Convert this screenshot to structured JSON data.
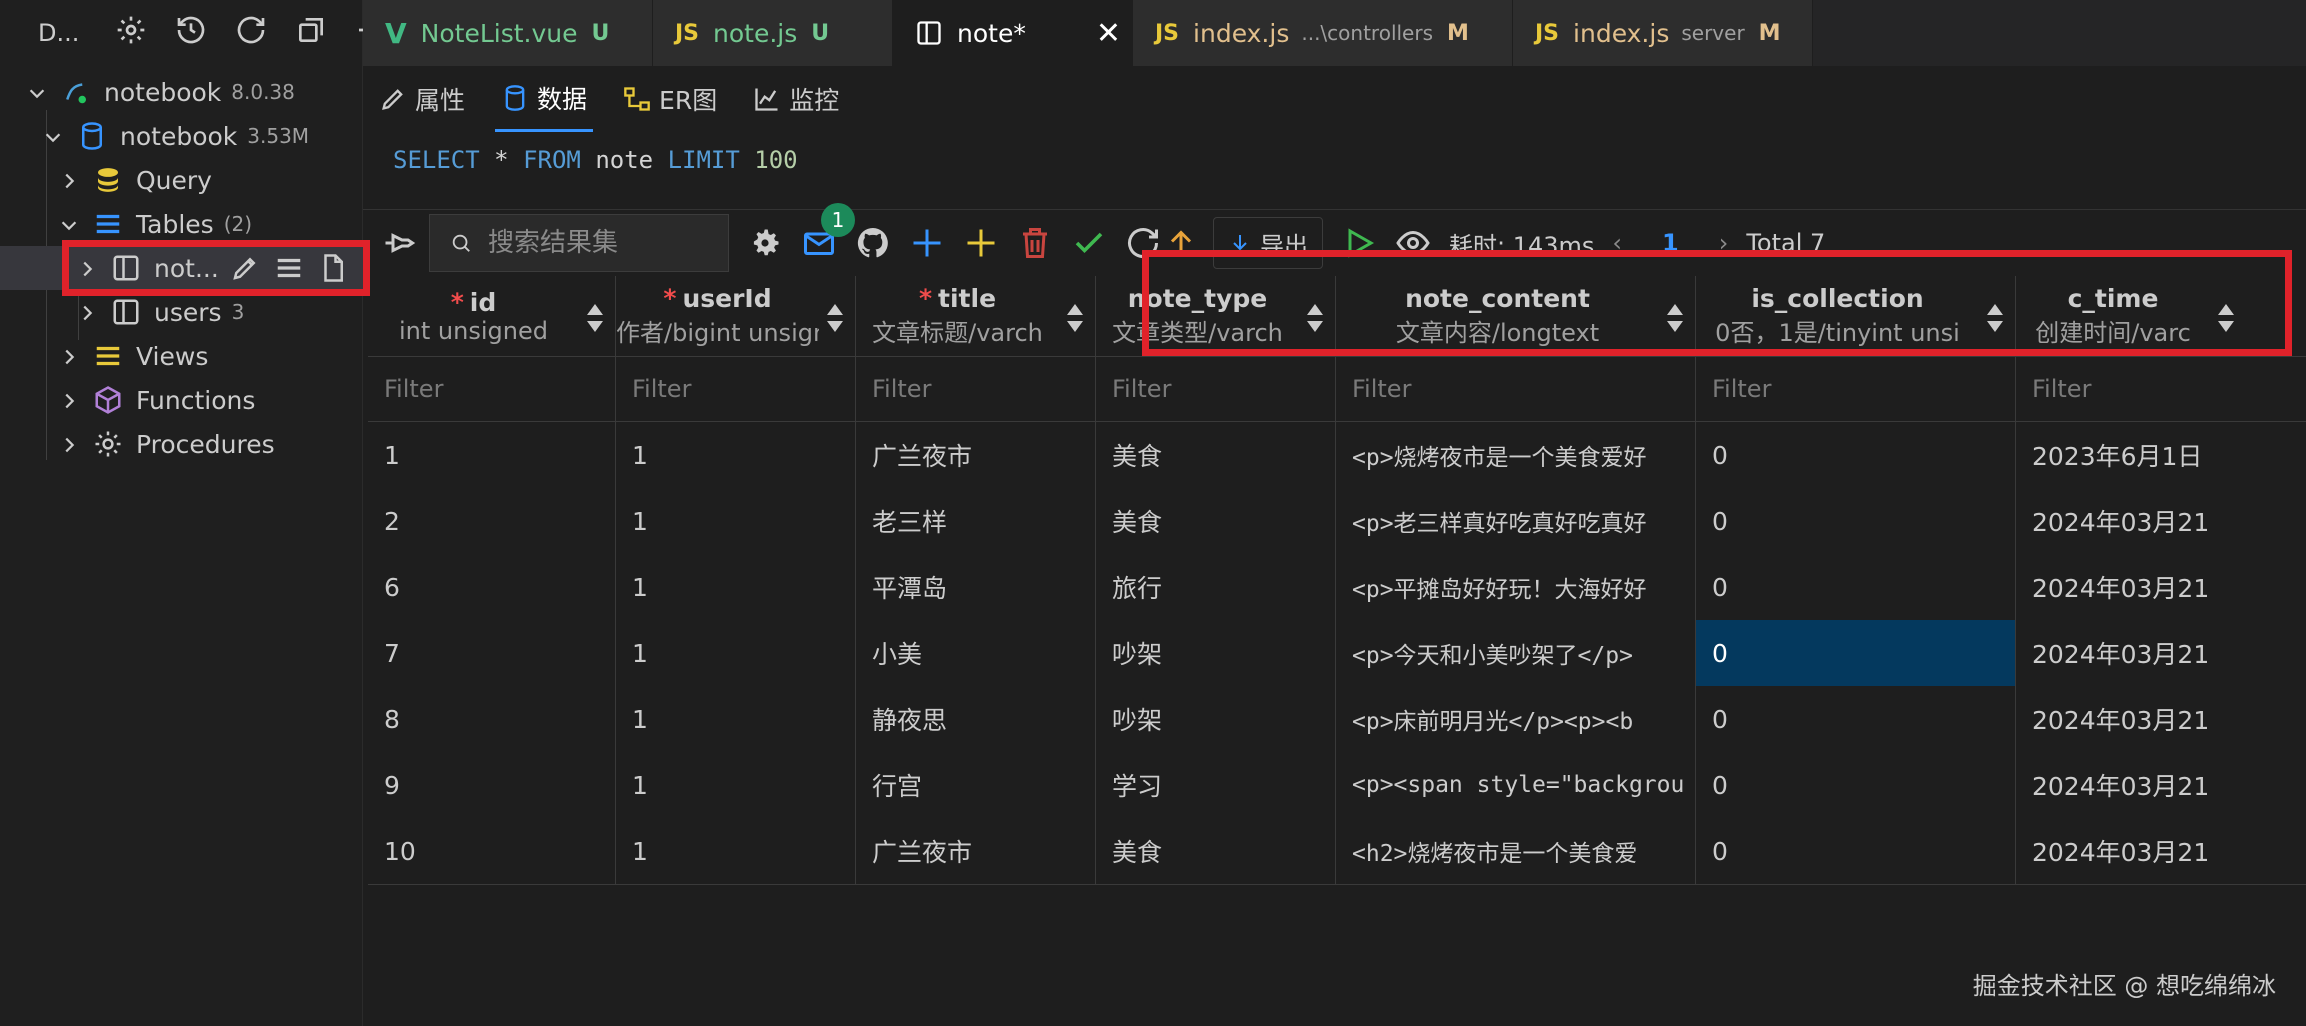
{
  "sidebar": {
    "title": "D...",
    "tree": [
      {
        "label": "notebook",
        "meta": "8.0.38",
        "icon": "mysql-connection-icon"
      },
      {
        "label": "notebook",
        "meta": "3.53M",
        "icon": "database-icon"
      },
      {
        "label": "Query",
        "meta": "",
        "icon": "query-stack-icon"
      },
      {
        "label": "Tables",
        "meta": "(2)",
        "icon": "tables-icon"
      },
      {
        "label": "not...",
        "meta": "",
        "icon": "table-icon"
      },
      {
        "label": "users",
        "meta": "3",
        "icon": "table-icon"
      },
      {
        "label": "Views",
        "meta": "",
        "icon": "views-icon"
      },
      {
        "label": "Functions",
        "meta": "",
        "icon": "function-cube-icon"
      },
      {
        "label": "Procedures",
        "meta": "",
        "icon": "gear-icon"
      }
    ]
  },
  "tabs": [
    {
      "label": "NoteList.vue",
      "status": "U",
      "path": ""
    },
    {
      "label": "note.js",
      "status": "U",
      "path": ""
    },
    {
      "label": "note*",
      "status": "",
      "path": ""
    },
    {
      "label": "index.js",
      "status": "M",
      "path": "...\\controllers"
    },
    {
      "label": "index.js",
      "status": "M",
      "path": "server"
    }
  ],
  "subtabs": [
    "属性",
    "数据",
    "ER图",
    "监控"
  ],
  "sql": {
    "select": "SELECT",
    "star": "*",
    "from": "FROM",
    "table": "note",
    "limit": "LIMIT",
    "limit_value": "100"
  },
  "toolbar": {
    "search_placeholder": "搜索结果集",
    "badge": "1",
    "export_label": "导出",
    "time_label": "耗时: 143ms",
    "page": "1",
    "total": "Total 7",
    "prev": "‹",
    "next": "›"
  },
  "columns": [
    {
      "name": "id",
      "type": "int unsigned",
      "required": "*"
    },
    {
      "name": "userId",
      "type": "作者/bigint unsigne",
      "required": "*"
    },
    {
      "name": "title",
      "type": "文章标题/varch",
      "required": "*"
    },
    {
      "name": "note_type",
      "type": "文章类型/varch",
      "required": ""
    },
    {
      "name": "note_content",
      "type": "文章内容/longtext",
      "required": ""
    },
    {
      "name": "is_collection",
      "type": "0否，1是/tinyint unsi",
      "required": ""
    },
    {
      "name": "c_time",
      "type": "创建时间/varc",
      "required": ""
    }
  ],
  "filter_placeholder": "Filter",
  "rows": [
    [
      "1",
      "1",
      "广兰夜市",
      "美食",
      "<p>烧烤夜市是一个美食爱好",
      "0",
      "2023年6月1日"
    ],
    [
      "2",
      "1",
      "老三样",
      "美食",
      "<p>老三样真好吃真好吃真好",
      "0",
      "2024年03月21"
    ],
    [
      "6",
      "1",
      "平潭岛",
      "旅行",
      "<p>平摊岛好好玩！大海好好",
      "0",
      "2024年03月21"
    ],
    [
      "7",
      "1",
      "小美",
      "吵架",
      "<p>今天和小美吵架了</p>",
      "0",
      "2024年03月21"
    ],
    [
      "8",
      "1",
      "静夜思",
      "吵架",
      "<p>床前明月光</p><p><b",
      "0",
      "2024年03月21"
    ],
    [
      "9",
      "1",
      "行宫",
      "学习",
      "<p><span style=\"backgrou",
      "0",
      "2024年03月21"
    ],
    [
      "10",
      "1",
      "广兰夜市",
      "美食",
      "<h2>烧烤夜市是一个美食爱",
      "0",
      "2024年03月21"
    ]
  ],
  "watermark": "掘金技术社区 @ 想吃绵绵冰",
  "colors": {
    "highlight_red": "#e0222a",
    "accent_blue": "#3794ff",
    "selected_cell": "#04395e"
  }
}
